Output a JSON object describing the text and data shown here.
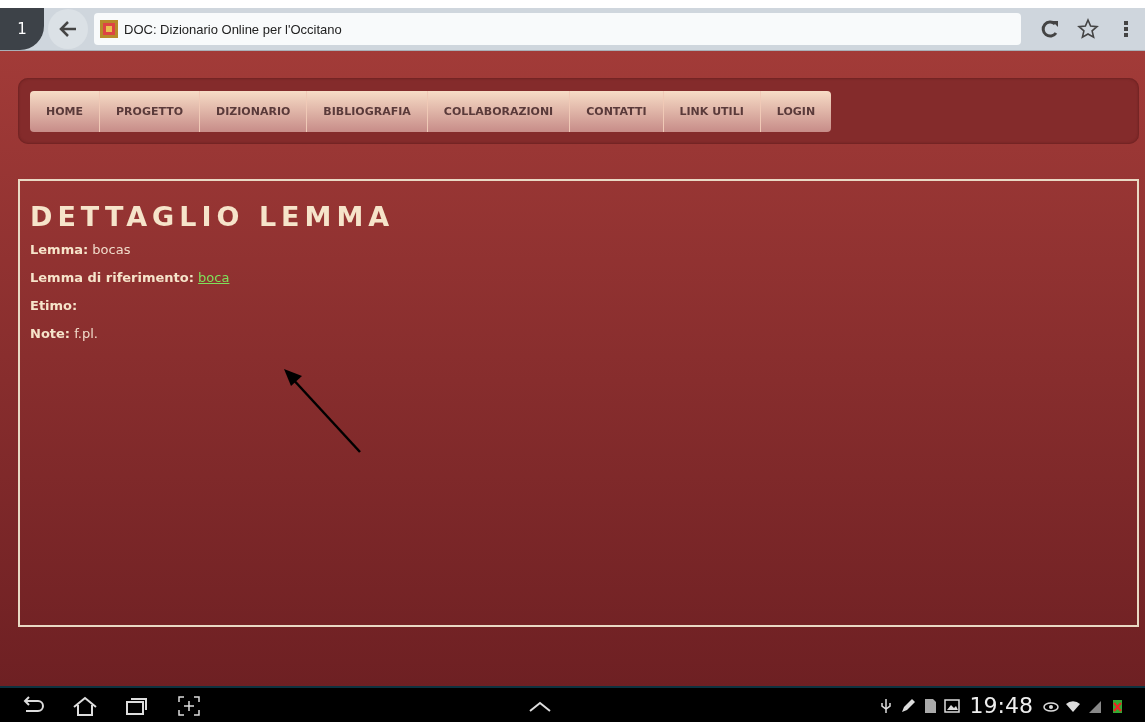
{
  "browser": {
    "tab_count": "1",
    "title": "DOC: Dizionario Online per l'Occitano"
  },
  "nav": [
    "HOME",
    "PROGETTO",
    "DIZIONARIO",
    "BIBLIOGRAFIA",
    "COLLABORAZIONI",
    "CONTATTI",
    "LINK UTILI",
    "LOGIN"
  ],
  "heading": "DETTAGLIO LEMMA",
  "fields": [
    {
      "label": "Lemma:",
      "value": "bocas",
      "kind": "text"
    },
    {
      "label": "Lemma di riferimento:",
      "value": "boca",
      "kind": "link"
    },
    {
      "label": "Etimo:",
      "kind": "text"
    },
    {
      "label": "Note:",
      "value": "f.pl.",
      "kind": "text"
    }
  ],
  "status_bar": {
    "time": "19:48"
  }
}
